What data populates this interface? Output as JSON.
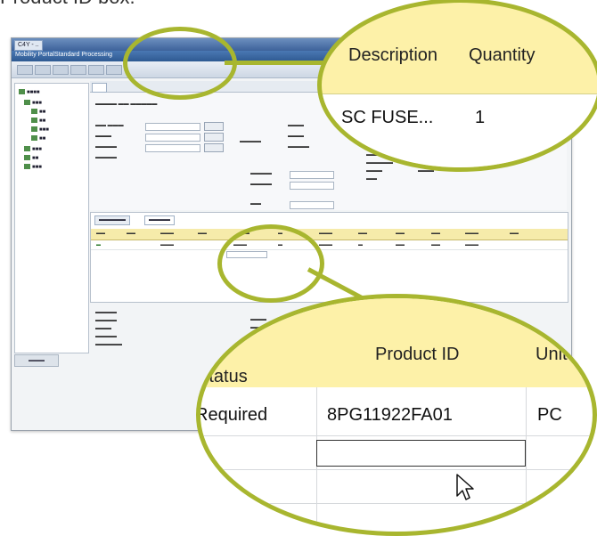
{
  "caption": "Product ID box.",
  "app": {
    "window_tab": "C4Y - ..",
    "menu": [
      "Mobility Portal",
      "Standard Processing",
      "Service",
      "Organisation",
      "Product",
      "Reports"
    ],
    "toolbar": [
      "Save",
      "Edit",
      "Close",
      "Preview",
      "Export",
      "Actions"
    ]
  },
  "zoom_top": {
    "headers": [
      "Description",
      "Quantity"
    ],
    "row": {
      "description": "SC FUSE...",
      "quantity": "1"
    }
  },
  "zoom_bottom": {
    "headers": [
      "al\nStatus",
      "Product ID",
      "Unit"
    ],
    "row": {
      "status": "Required",
      "product_id": "8PG11922FA01",
      "unit": "PC"
    },
    "new_product_id": ""
  },
  "colors": {
    "accent_ring": "#a8b62f",
    "header_fill": "#fdf1a8"
  }
}
